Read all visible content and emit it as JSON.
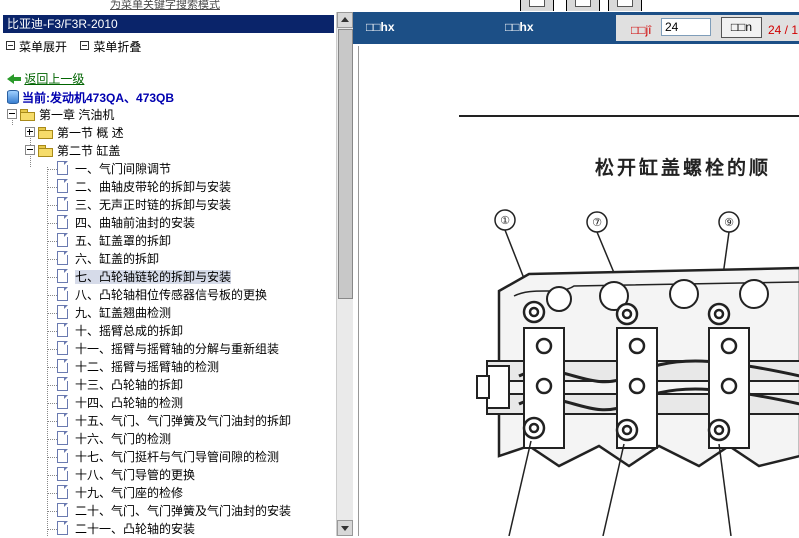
{
  "top": {
    "link_text": "为菜单关键字搜索模式"
  },
  "left": {
    "header_title": "比亚迪-F3/F3R-2010",
    "menu_expand": "菜单展开",
    "menu_collapse": "菜单折叠",
    "back_label": "返回上一级",
    "current_label": "当前:发动机473QA、473QB",
    "chapter": "第一章  汽油机",
    "section1": "第一节  概  述",
    "section2": "第二节  缸盖",
    "items": [
      "一、气门间隙调节",
      "二、曲轴皮带轮的拆卸与安装",
      "三、无声正时链的拆卸与安装",
      "四、曲轴前油封的安装",
      "五、缸盖罩的拆卸",
      "六、缸盖的拆卸",
      "七、凸轮轴链轮的拆卸与安装",
      "八、凸轮轴相位传感器信号板的更换",
      "九、缸盖翘曲检测",
      "十、摇臂总成的拆卸",
      "十一、摇臂与摇臂轴的分解与重新组装",
      "十二、摇臂与摇臂轴的检测",
      "十三、凸轮轴的拆卸",
      "十四、凸轮轴的检测",
      "十五、气门、气门弹簧及气门油封的拆卸",
      "十六、气门的检测",
      "十七、气门挺杆与气门导管间隙的检测",
      "十八、气门导管的更换",
      "十九、气门座的检修",
      "二十、气门、气门弹簧及气门油封的安装",
      "二十一、凸轮轴的安装"
    ],
    "selected_index": 6
  },
  "right": {
    "toolbar_label_1": "□□hx",
    "toolbar_label_2": "□□hx",
    "page_prefix": "□□jî",
    "page_input_value": "24",
    "go_label": "□□n",
    "page_count": "24 / 1",
    "diagram": {
      "title": "松开缸盖螺栓的顺",
      "callouts": [
        "①",
        "⑦",
        "⑨"
      ]
    }
  }
}
